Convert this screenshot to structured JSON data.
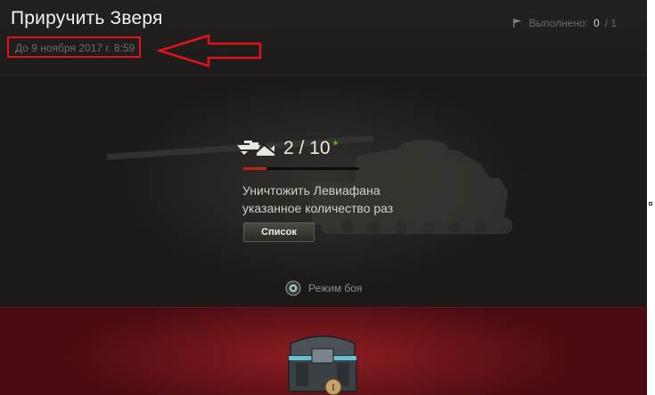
{
  "quest": {
    "title": "Приручить Зверя",
    "deadline": "До 9 ноября 2017 г. 8:59",
    "completed_label": "Выполнено:",
    "completed_current": "0",
    "completed_total": "/ 1"
  },
  "task": {
    "progress_text": "2 / 10",
    "progress_star": "*",
    "progress_value": 2,
    "progress_max": 10,
    "description_line1": "Уничтожить Левиафана",
    "description_line2": "указанное количество раз",
    "list_button_label": "Список"
  },
  "battle_mode": {
    "label": "Режим боя"
  },
  "reward": {
    "icon": "loot-box-chest-icon",
    "badge": "I"
  },
  "colors": {
    "accent_red": "#e3111b",
    "progress_red": "#b8231a",
    "star_green": "#5ad21e",
    "reward_band": "#8e1d22"
  }
}
